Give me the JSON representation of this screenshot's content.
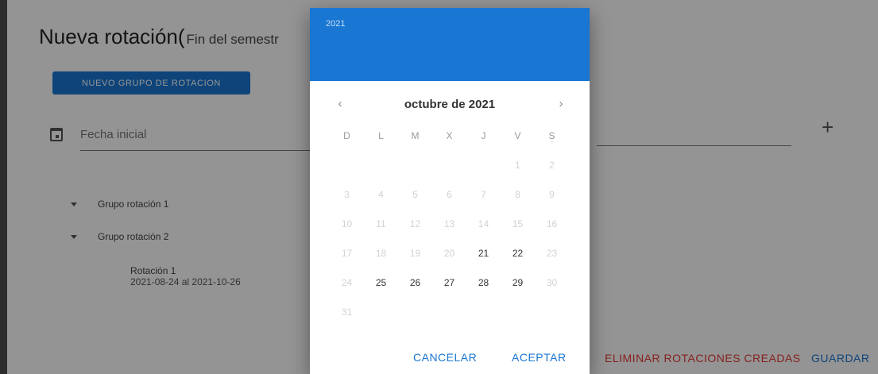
{
  "page": {
    "title": "Nueva rotación(",
    "subtitle": "Fin del semestr",
    "new_group_button": "NUEVO GRUPO DE ROTACION",
    "date_field_label": "Fecha inicial",
    "add_icon": "plus-icon",
    "calendar_icon": "calendar-icon",
    "groups": [
      {
        "label": "Grupo rotación 1"
      },
      {
        "label": "Grupo rotación 2"
      }
    ],
    "rotation": {
      "name": "Rotación 1",
      "range": "2021-08-24 al 2021-10-26"
    },
    "delete_button": "ELIMINAR ROTACIONES CREADAS",
    "save_button": "GUARDAR"
  },
  "picker": {
    "year": "2021",
    "month_label": "octubre de 2021",
    "prev_icon": "‹",
    "next_icon": "›",
    "weekdays": [
      "D",
      "L",
      "M",
      "X",
      "J",
      "V",
      "S"
    ],
    "weeks": [
      [
        {
          "d": ""
        },
        {
          "d": ""
        },
        {
          "d": ""
        },
        {
          "d": ""
        },
        {
          "d": ""
        },
        {
          "d": "1",
          "dis": true
        },
        {
          "d": "2",
          "dis": true
        }
      ],
      [
        {
          "d": "3",
          "dis": true
        },
        {
          "d": "4",
          "dis": true
        },
        {
          "d": "5",
          "dis": true
        },
        {
          "d": "6",
          "dis": true
        },
        {
          "d": "7",
          "dis": true
        },
        {
          "d": "8",
          "dis": true
        },
        {
          "d": "9",
          "dis": true
        }
      ],
      [
        {
          "d": "10",
          "dis": true
        },
        {
          "d": "11",
          "dis": true
        },
        {
          "d": "12",
          "dis": true
        },
        {
          "d": "13",
          "dis": true
        },
        {
          "d": "14",
          "dis": true
        },
        {
          "d": "15",
          "dis": true
        },
        {
          "d": "16",
          "dis": true
        }
      ],
      [
        {
          "d": "17",
          "dis": true
        },
        {
          "d": "18",
          "dis": true
        },
        {
          "d": "19",
          "dis": true
        },
        {
          "d": "20",
          "dis": true
        },
        {
          "d": "21"
        },
        {
          "d": "22"
        },
        {
          "d": "23",
          "dis": true
        }
      ],
      [
        {
          "d": "24",
          "dis": true
        },
        {
          "d": "25"
        },
        {
          "d": "26"
        },
        {
          "d": "27"
        },
        {
          "d": "28"
        },
        {
          "d": "29"
        },
        {
          "d": "30",
          "dis": true
        }
      ],
      [
        {
          "d": "31",
          "dis": true
        },
        {
          "d": ""
        },
        {
          "d": ""
        },
        {
          "d": ""
        },
        {
          "d": ""
        },
        {
          "d": ""
        },
        {
          "d": ""
        }
      ]
    ],
    "cancel": "CANCELAR",
    "accept": "ACEPTAR"
  }
}
